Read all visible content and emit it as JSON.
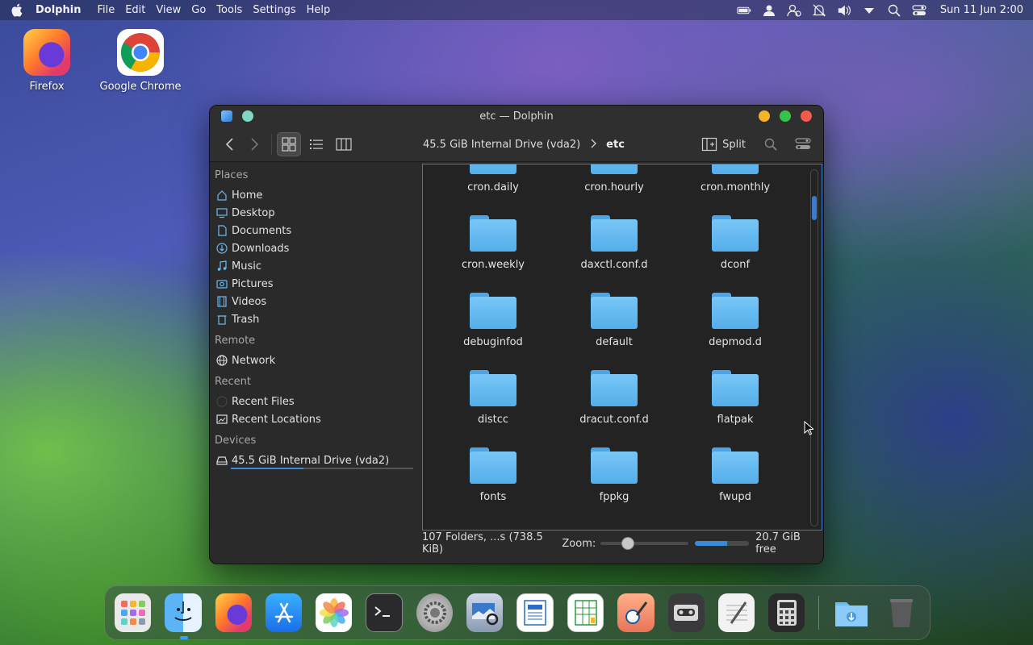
{
  "menubar": {
    "app_name": "Dolphin",
    "menus": [
      "File",
      "Edit",
      "View",
      "Go",
      "Tools",
      "Settings",
      "Help"
    ],
    "clock": "Sun 11 Jun 2:00"
  },
  "desktop": {
    "icons": [
      {
        "label": "Firefox"
      },
      {
        "label": "Google Chrome"
      }
    ]
  },
  "window": {
    "title": "etc — Dolphin",
    "breadcrumb": {
      "parent": "45.5 GiB Internal Drive (vda2)",
      "current": "etc"
    },
    "split_label": "Split",
    "sidebar": {
      "places_heading": "Places",
      "places": [
        "Home",
        "Desktop",
        "Documents",
        "Downloads",
        "Music",
        "Pictures",
        "Videos",
        "Trash"
      ],
      "remote_heading": "Remote",
      "remote": [
        "Network"
      ],
      "recent_heading": "Recent",
      "recent": [
        "Recent Files",
        "Recent Locations"
      ],
      "devices_heading": "Devices",
      "devices": [
        "45.5 GiB Internal Drive (vda2)"
      ]
    },
    "files": [
      "cron.daily",
      "cron.hourly",
      "cron.monthly",
      "cron.weekly",
      "daxctl.conf.d",
      "dconf",
      "debuginfod",
      "default",
      "depmod.d",
      "distcc",
      "dracut.conf.d",
      "flatpak",
      "fonts",
      "fppkg",
      "fwupd"
    ],
    "status": {
      "summary": "107 Folders, ...s (738.5 KiB)",
      "zoom_label": "Zoom:",
      "zoom_value_fraction": 0.2,
      "free_fraction": 0.55,
      "free_text": "20.7 GiB free"
    }
  },
  "dock": {
    "items": [
      "launchpad-icon",
      "finder-icon",
      "firefox-icon",
      "app-store-icon",
      "photos-icon",
      "terminal-icon",
      "system-settings-icon",
      "screenshot-icon",
      "writer-icon",
      "calc-icon",
      "paint-icon",
      "media-icon",
      "text-editor-icon",
      "calculator-icon",
      "downloads-folder-icon",
      "trash-icon"
    ]
  },
  "colors": {
    "accent": "#3a8ad8",
    "folder": "#5ab2ec",
    "window_bg": "#2a2a2b"
  }
}
